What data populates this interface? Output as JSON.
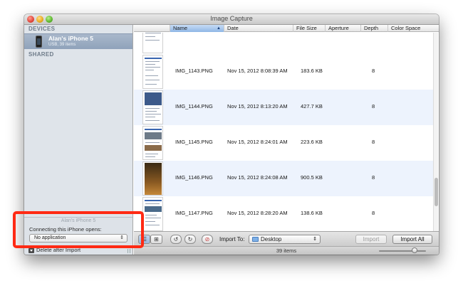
{
  "window": {
    "title": "Image Capture"
  },
  "sidebar": {
    "devices_header": "DEVICES",
    "shared_header": "SHARED",
    "device": {
      "name": "Alan's iPhone 5",
      "subtitle": "USB, 39 items",
      "icon": "iphone-icon"
    },
    "device_footer_label": "Alan's iPhone 5",
    "connecting_label": "Connecting this iPhone opens:",
    "open_with_value": "No application",
    "delete_after_import_label": "Delete after Import",
    "delete_after_import_checked": false
  },
  "table": {
    "columns": [
      "Name",
      "Date",
      "File Size",
      "Aperture",
      "Depth",
      "Color Space"
    ],
    "sorted_column": "Name",
    "rows": [
      {
        "name": "IMG_1143.PNG",
        "date": "Nov 15, 2012 8:08:39 AM",
        "size": "183.6 KB",
        "aperture": "",
        "depth": "8",
        "color_space": ""
      },
      {
        "name": "IMG_1144.PNG",
        "date": "Nov 15, 2012 8:13:20 AM",
        "size": "427.7 KB",
        "aperture": "",
        "depth": "8",
        "color_space": ""
      },
      {
        "name": "IMG_1145.PNG",
        "date": "Nov 15, 2012 8:24:01 AM",
        "size": "223.6 KB",
        "aperture": "",
        "depth": "8",
        "color_space": ""
      },
      {
        "name": "IMG_1146.PNG",
        "date": "Nov 15, 2012 8:24:08 AM",
        "size": "900.5 KB",
        "aperture": "",
        "depth": "8",
        "color_space": ""
      },
      {
        "name": "IMG_1147.PNG",
        "date": "Nov 15, 2012 8:28:20 AM",
        "size": "138.6 KB",
        "aperture": "",
        "depth": "8",
        "color_space": ""
      }
    ]
  },
  "toolbar": {
    "import_to_label": "Import To:",
    "destination": "Desktop",
    "import_label": "Import",
    "import_all_label": "Import All",
    "view_mode": "list"
  },
  "status": {
    "items_text": "39 items",
    "thumbnail_size_fraction": 0.8
  },
  "colors": {
    "selection": "#8fa2ba",
    "alt_row": "#edf3fd",
    "highlight": "#ff2a14",
    "sort_header": "#8fb6e6"
  }
}
